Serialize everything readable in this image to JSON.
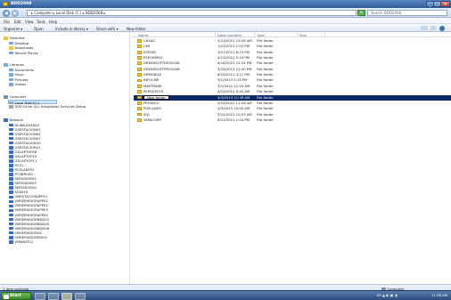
{
  "window": {
    "title": "BDD2008",
    "min": "_",
    "max": "□",
    "close": "×"
  },
  "address": {
    "back": "◀",
    "forward": "▶",
    "path": "▸ Computer ▸ Local Disk (C:) ▸ BDD2008 ▸",
    "refresh": "↻",
    "search_placeholder": "Search BDD2008"
  },
  "menu": [
    "File",
    "Edit",
    "View",
    "Tools",
    "Help"
  ],
  "toolbar": {
    "organize": "Organize ▾",
    "open": "Open",
    "include": "Include in library ▾",
    "share": "Share with ▾",
    "new_folder": "New folder"
  },
  "nav": {
    "favorites_header": "Favorites",
    "favorites": [
      "Desktop",
      "Downloads",
      "Recent Places"
    ],
    "libraries_header": "Libraries",
    "libraries": [
      "Documents",
      "Music",
      "Pictures",
      "Videos"
    ],
    "computer_header": "Computer",
    "drives": [
      "Local Disk (C:)",
      "DVD Drive (D:) Integration Services Setup"
    ],
    "network_header": "Network",
    "network": [
      "DLINK-XXXSA3",
      "GSESTACION01",
      "GSESTACION04",
      "GSESTACION07",
      "GSESTACION10",
      "GSESTACION11",
      "GSLAPTOP08",
      "GSLAPTOP10",
      "GSLAPTOP11",
      "PC01",
      "PCSLADY52",
      "PCSBRUZO",
      "SERVIDOR02",
      "SERVIDOR03",
      "SERVIDOR04",
      "SVDEHI",
      "VMESTACIONAPP01",
      "VMSERVIDORAPP01",
      "VMSERVIDORAPP02",
      "VMSERVIDORAPP03",
      "VMSERVIDORAPP04",
      "VMSERVIDORBDD01",
      "VMSERVIDORBDD05",
      "VMSERVIDORBDD06",
      "VMSERVIDORDC",
      "VMSERVIDORVDI01",
      "VMWINT01"
    ]
  },
  "columns": {
    "name": "Name",
    "date": "Date modified",
    "type": "Type",
    "size": "Size"
  },
  "files": [
    {
      "name": "CASAS",
      "date": "4/13/2012 10:26 AM",
      "type": "File folder"
    },
    {
      "name": "CMI",
      "date": "1/23/2013 1:03 PM",
      "type": "File folder"
    },
    {
      "name": "ESPOIR",
      "date": "10/7/2011 6:23 PM",
      "type": "File folder"
    },
    {
      "name": "ESPOIRREV",
      "date": "4/13/2012 5:19 PM",
      "type": "File folder"
    },
    {
      "name": "GREENSOFTDES2008",
      "date": "6/18/2012 12:34 PM",
      "type": "File folder"
    },
    {
      "name": "GREENSOFTPRO2008",
      "date": "3/29/2012 12:40 PM",
      "type": "File folder"
    },
    {
      "name": "GRMOBILE",
      "date": "8/29/2011 4:11 PM",
      "type": "File folder"
    },
    {
      "name": "INFOCME",
      "date": "3/1/2013 5:15 PM",
      "type": "File folder"
    },
    {
      "name": "MAKTRADE",
      "date": "3/1/2012 11:20 AM",
      "type": "File folder"
    },
    {
      "name": "PERSATECH",
      "date": "4/13/2012 9:45 AM",
      "type": "File folder"
    },
    {
      "name": "New folder",
      "date": "4/3/2013 11:38 AM",
      "type": "File folder",
      "selected": true
    },
    {
      "name": "PROINCO",
      "date": "2/24/2012 11:26 AM",
      "type": "File folder"
    },
    {
      "name": "PUELLARO",
      "date": "4/3/2013 10:00 AM",
      "type": "File folder"
    },
    {
      "name": "SQL",
      "date": "3/12/2012 10:33 AM",
      "type": "File folder"
    },
    {
      "name": "YAPACORP",
      "date": "6/21/2011 1:04 PM",
      "type": "File folder"
    }
  ],
  "status": {
    "left": "1 item selected",
    "right": "Computer"
  },
  "taskbar": {
    "start": "Start",
    "tray": "ES  ▲  ◐  ▣  ◑",
    "clock": "11:38 AM"
  }
}
